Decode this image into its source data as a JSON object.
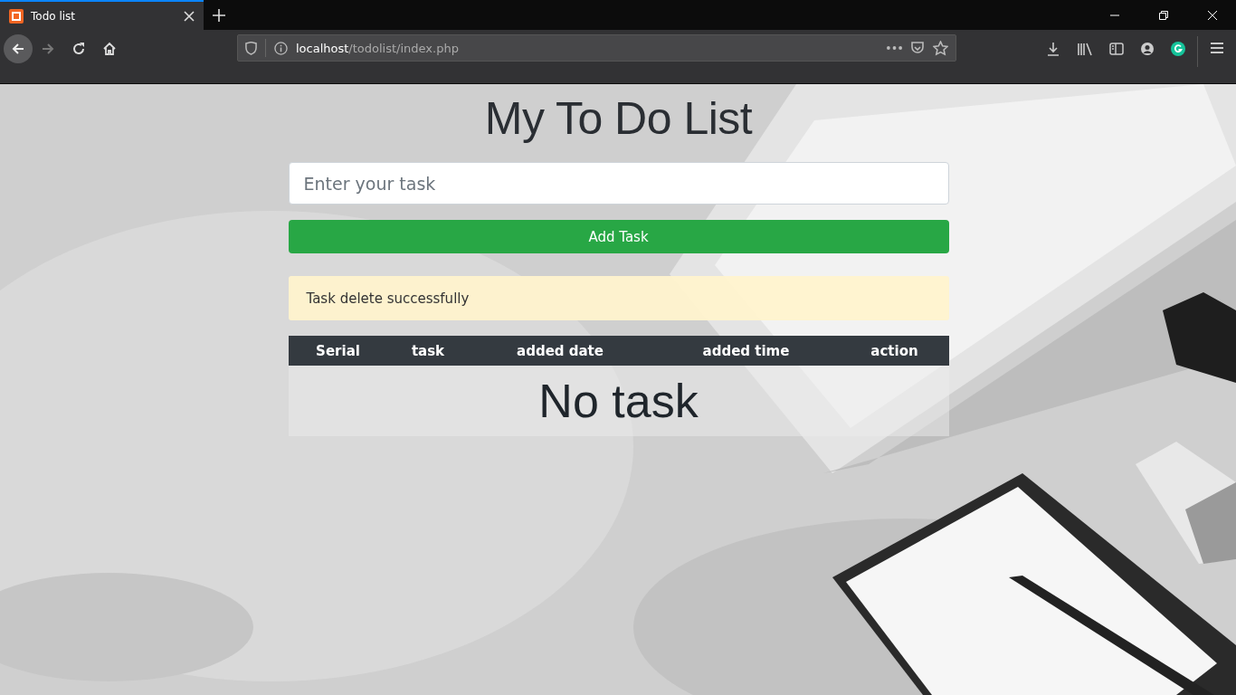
{
  "browser": {
    "tab": {
      "title": "Todo list",
      "selected": true
    },
    "address": {
      "host": "localhost",
      "path": "/todolist/index.php"
    }
  },
  "page": {
    "title": "My To Do List",
    "task_input": {
      "placeholder": "Enter your task"
    },
    "add_button": "Add Task",
    "alert": {
      "kind": "warning",
      "text": "Task delete successfully"
    },
    "table": {
      "columns": [
        "Serial",
        "task",
        "added date",
        "added time",
        "action"
      ],
      "empty_text": "No task"
    }
  }
}
